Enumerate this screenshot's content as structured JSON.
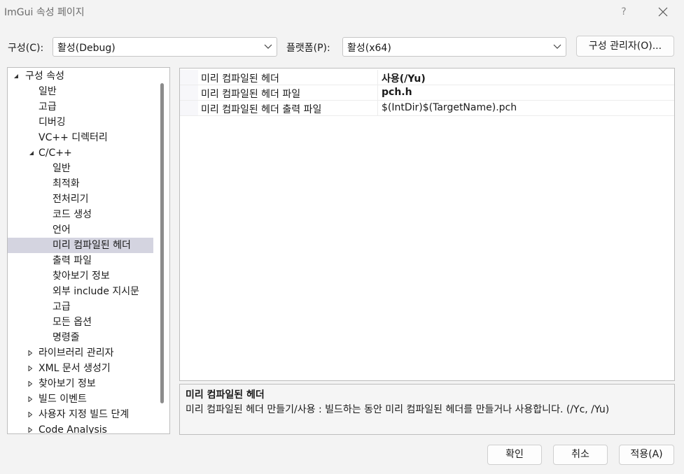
{
  "window": {
    "title": "ImGui 속성 페이지",
    "help": "?"
  },
  "toolbar": {
    "config_label": "구성(C):",
    "config_value": "활성(Debug)",
    "platform_label": "플랫폼(P):",
    "platform_value": "활성(x64)",
    "config_manager": "구성 관리자(O)..."
  },
  "tree": {
    "root": "구성 속성",
    "items": [
      "일반",
      "고급",
      "디버깅",
      "VC++ 디렉터리"
    ],
    "cpp": "C/C++",
    "cpp_items": [
      "일반",
      "최적화",
      "전처리기",
      "코드 생성",
      "언어",
      "미리 컴파일된 헤더",
      "출력 파일",
      "찾아보기 정보",
      "외부 include 지시문",
      "고급",
      "모든 옵션",
      "명령줄"
    ],
    "collapsed": [
      "라이브러리 관리자",
      "XML 문서 생성기",
      "찾아보기 정보",
      "빌드 이벤트",
      "사용자 지정 빌드 단계",
      "Code Analysis"
    ],
    "selected": "미리 컴파일된 헤더"
  },
  "grid": {
    "rows": [
      {
        "name": "미리 컴파일된 헤더",
        "value": "사용(/Yu)"
      },
      {
        "name": "미리 컴파일된 헤더 파일",
        "value": "pch.h"
      },
      {
        "name": "미리 컴파일된 헤더 출력 파일",
        "value": "$(IntDir)$(TargetName).pch"
      }
    ]
  },
  "description": {
    "title": "미리 컴파일된 헤더",
    "text": "미리 컴파일된 헤더 만들기/사용 : 빌드하는 동안 미리 컴파일된 헤더를 만들거나 사용합니다.     (/Yc, /Yu)"
  },
  "buttons": {
    "ok": "확인",
    "cancel": "취소",
    "apply": "적용(A)"
  }
}
